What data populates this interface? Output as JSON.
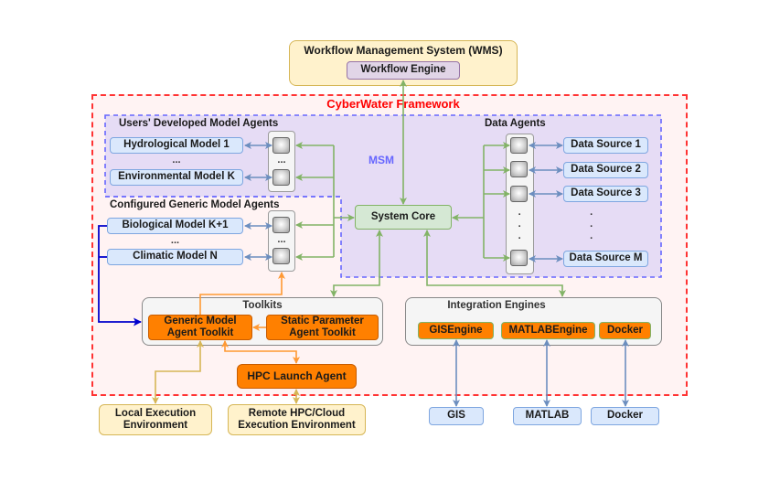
{
  "wms": {
    "title": "Workflow Management System (WMS)",
    "engine": "Workflow Engine"
  },
  "framework": {
    "title": "CyberWater Framework",
    "msm_label": "MSM"
  },
  "users_developed": {
    "title": "Users' Developed Model Agents",
    "models": [
      "Hydrological Model 1",
      "Environmental Model K"
    ],
    "ellipsis": "..."
  },
  "configured_generic": {
    "title": "Configured Generic Model Agents",
    "models": [
      "Biological Model K+1",
      "Climatic Model N"
    ],
    "ellipsis": "..."
  },
  "agent_ellipsis": "...",
  "system_core": "System Core",
  "data_agents": {
    "title": "Data Agents",
    "sources": [
      "Data Source 1",
      "Data Source 2",
      "Data Source 3",
      "Data Source M"
    ],
    "vertical_dots": "·"
  },
  "toolkits": {
    "title": "Toolkits",
    "generic": "Generic Model Agent Toolkit",
    "static": "Static Parameter Agent Toolkit"
  },
  "integration": {
    "title": "Integration Engines",
    "engines": [
      "GISEngine",
      "MATLABEngine",
      "Docker"
    ]
  },
  "hpc_launch": "HPC Launch Agent",
  "environments": {
    "local": "Local Execution Environment",
    "remote": "Remote HPC/Cloud Execution Environment"
  },
  "external": [
    "GIS",
    "MATLAB",
    "Docker"
  ],
  "colors": {
    "framework_border": "#ff3333",
    "msm_border": "#6666ff",
    "msm_fill": "#e6dcf5",
    "green_arrow": "#82b366",
    "blue_arrow": "#6c8ebf",
    "orange_arrow": "#ff9933",
    "yellow_arrow": "#d6b656",
    "dark_blue_arrow": "#0000cc"
  }
}
